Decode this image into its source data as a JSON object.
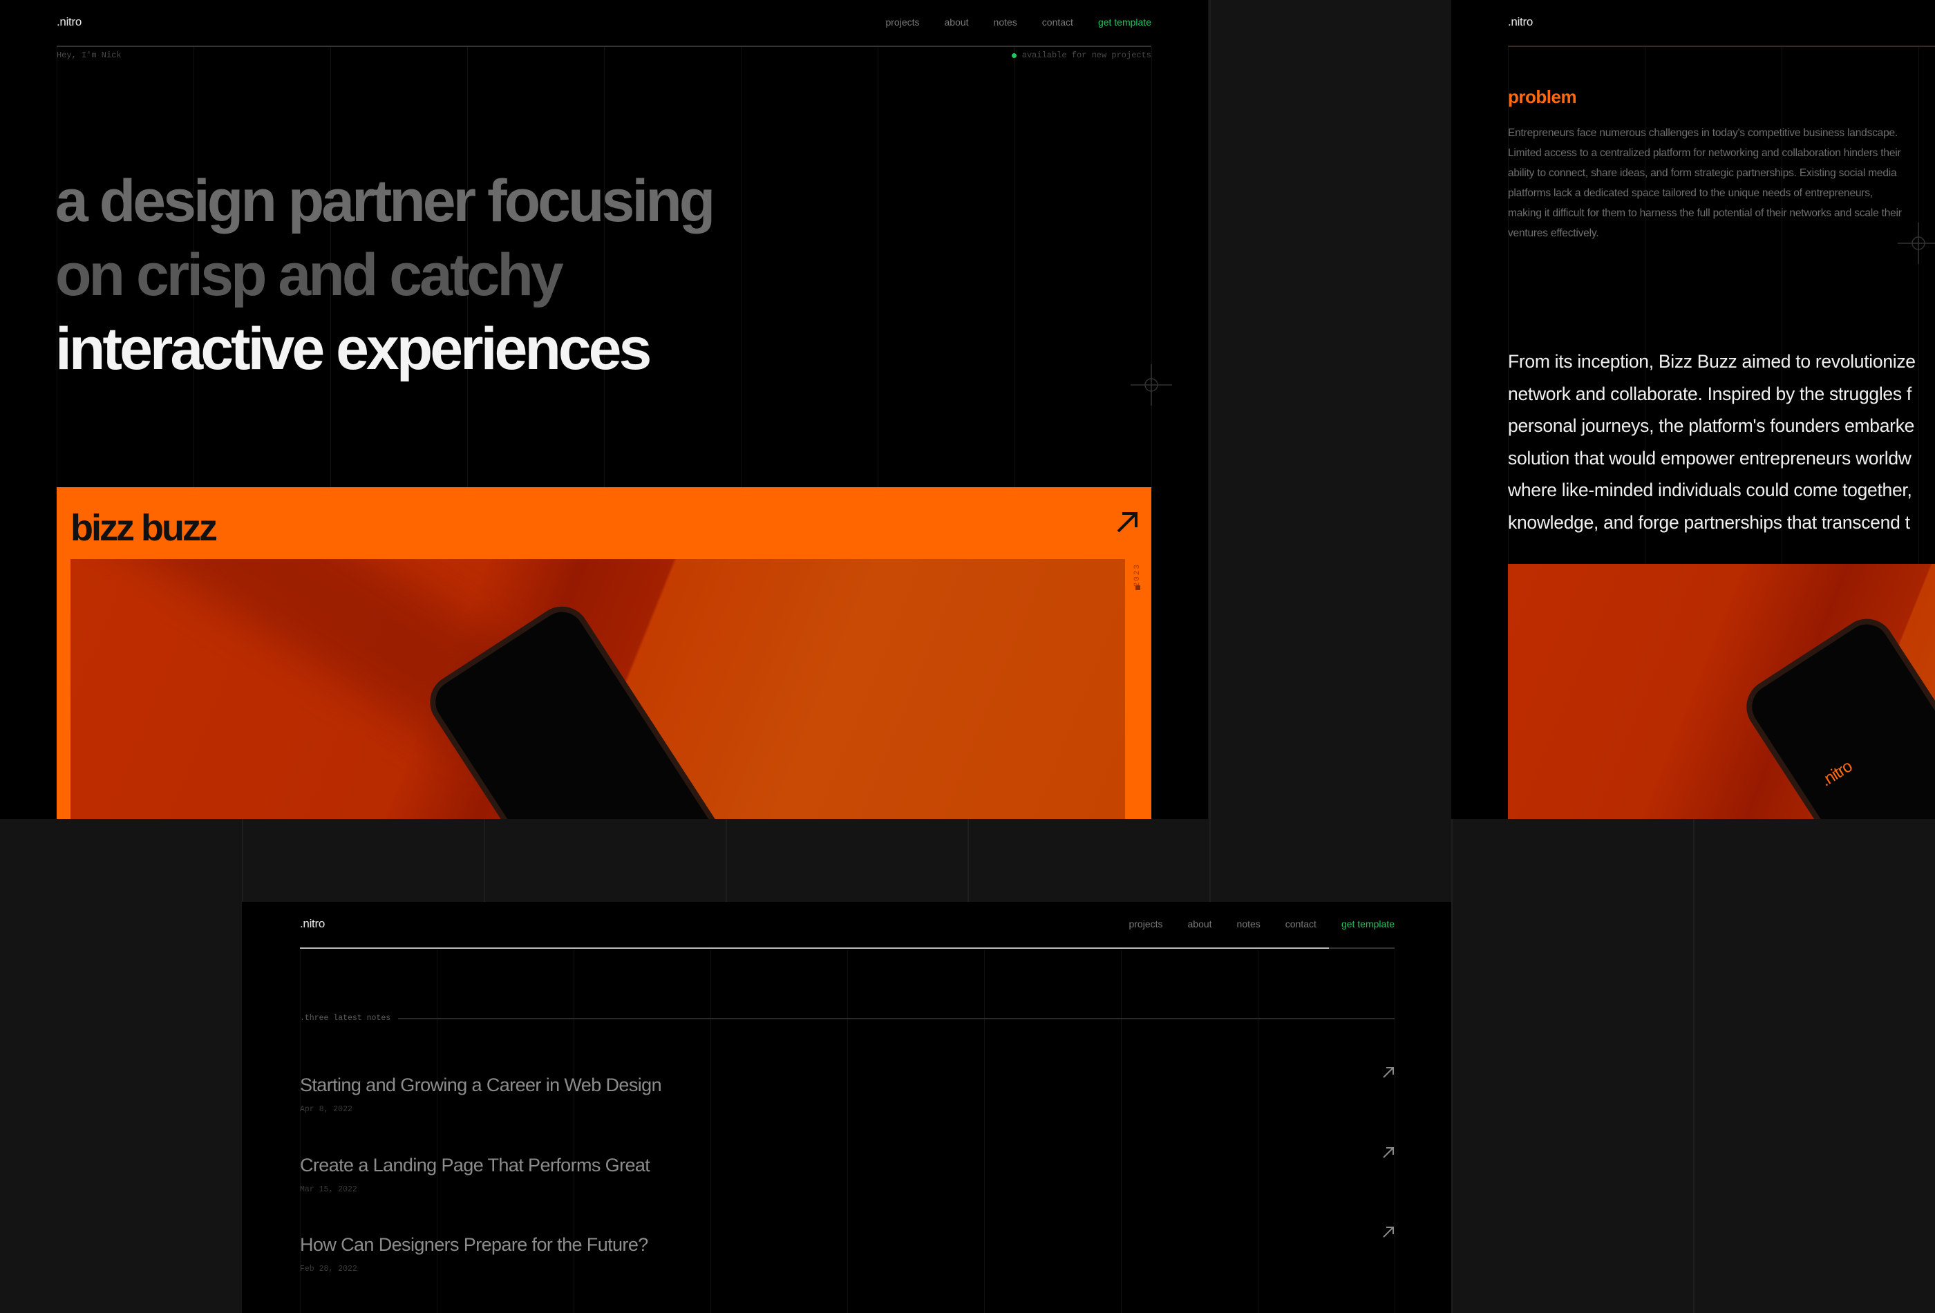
{
  "colors": {
    "accent_orange": "#ff6600",
    "accent_green": "#22c55e",
    "background": "#141414",
    "panel": "#000000"
  },
  "hero_page": {
    "logo": ".nitro",
    "nav": [
      "projects",
      "about",
      "notes",
      "contact"
    ],
    "nav_cta": "get template",
    "greeting": "Hey, I'm Nick",
    "availability": "available for new projects",
    "headline": {
      "line1": "a design partner focusing",
      "line2": "on crisp and catchy",
      "line3": "interactive experiences"
    },
    "featured_project": {
      "title": "bizz buzz",
      "year": "2023",
      "arrow_icon": "arrow-up-right-icon"
    }
  },
  "case_page": {
    "logo": ".nitro",
    "problem_heading": "problem",
    "problem_body": "Entrepreneurs face numerous challenges in today's competitive business landscape. Limited access to a centralized platform for networking and collaboration hinders their ability to connect, share ideas, and form strategic partnerships. Existing social media platforms lack a dedicated space tailored to the unique needs of entrepreneurs, making it difficult for them to harness the full potential of their networks and scale their ventures effectively.",
    "story_lines": [
      "From its inception, Bizz Buzz aimed to revolutionize",
      "network and collaborate. Inspired by the struggles f",
      "personal journeys, the platform's founders embarke",
      "solution that would empower entrepreneurs worldw",
      "where like-minded individuals could come together,",
      "knowledge, and forge partnerships that transcend t"
    ],
    "phone_screen_text": ".nitro"
  },
  "notes_page": {
    "logo": ".nitro",
    "nav": [
      "projects",
      "about",
      "notes",
      "contact"
    ],
    "nav_cta": "get template",
    "scroll_progress_percent": 94,
    "section_label": ".three latest notes",
    "notes": [
      {
        "title": "Starting and Growing a Career in Web Design",
        "date": "Apr 8, 2022"
      },
      {
        "title": "Create a Landing Page That Performs Great",
        "date": "Mar 15, 2022"
      },
      {
        "title": "How Can Designers Prepare for the Future?",
        "date": "Feb 28, 2022"
      }
    ]
  }
}
